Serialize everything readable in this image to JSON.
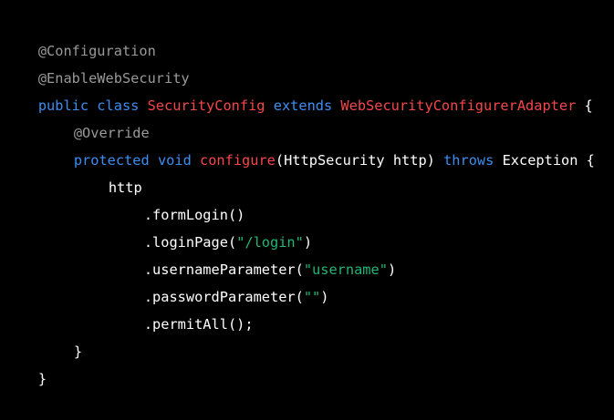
{
  "colors": {
    "background": "#000000",
    "annotation": "#999999",
    "keyword": "#3d8ef0",
    "identifier": "#f4474b",
    "plain": "#ffffff",
    "string": "#22b573"
  },
  "lines": [
    {
      "tokens": [
        {
          "text": "@Configuration",
          "kind": "anno"
        }
      ]
    },
    {
      "tokens": [
        {
          "text": "@EnableWebSecurity",
          "kind": "anno"
        }
      ]
    },
    {
      "tokens": [
        {
          "text": "public class ",
          "kind": "kw"
        },
        {
          "text": "SecurityConfig ",
          "kind": "id"
        },
        {
          "text": "extends ",
          "kind": "kw"
        },
        {
          "text": "WebSecurityConfigurerAdapter ",
          "kind": "id"
        },
        {
          "text": "{",
          "kind": "plain"
        }
      ]
    },
    {
      "tokens": [
        {
          "text": "@Override",
          "kind": "anno"
        }
      ]
    },
    {
      "tokens": [
        {
          "text": "protected void ",
          "kind": "kw"
        },
        {
          "text": "configure",
          "kind": "id"
        },
        {
          "text": "(HttpSecurity http) ",
          "kind": "plain"
        },
        {
          "text": "throws ",
          "kind": "kw"
        },
        {
          "text": "Exception {",
          "kind": "plain"
        }
      ]
    },
    {
      "tokens": [
        {
          "text": "http",
          "kind": "plain"
        }
      ]
    },
    {
      "tokens": [
        {
          "text": ".formLogin()",
          "kind": "plain"
        }
      ]
    },
    {
      "tokens": [
        {
          "text": ".loginPage(",
          "kind": "plain"
        },
        {
          "text": "\"/login\"",
          "kind": "str"
        },
        {
          "text": ")",
          "kind": "plain"
        }
      ]
    },
    {
      "tokens": [
        {
          "text": ".usernameParameter(",
          "kind": "plain"
        },
        {
          "text": "\"username\"",
          "kind": "str"
        },
        {
          "text": ")",
          "kind": "plain"
        }
      ]
    },
    {
      "tokens": [
        {
          "text": ".passwordParameter(",
          "kind": "plain"
        },
        {
          "text": "\"\"",
          "kind": "str"
        },
        {
          "text": ")",
          "kind": "plain"
        }
      ]
    },
    {
      "tokens": [
        {
          "text": ".permitAll();",
          "kind": "plain"
        }
      ]
    },
    {
      "tokens": [
        {
          "text": "}",
          "kind": "plain"
        }
      ]
    },
    {
      "tokens": [
        {
          "text": "}",
          "kind": "plain"
        }
      ]
    }
  ]
}
